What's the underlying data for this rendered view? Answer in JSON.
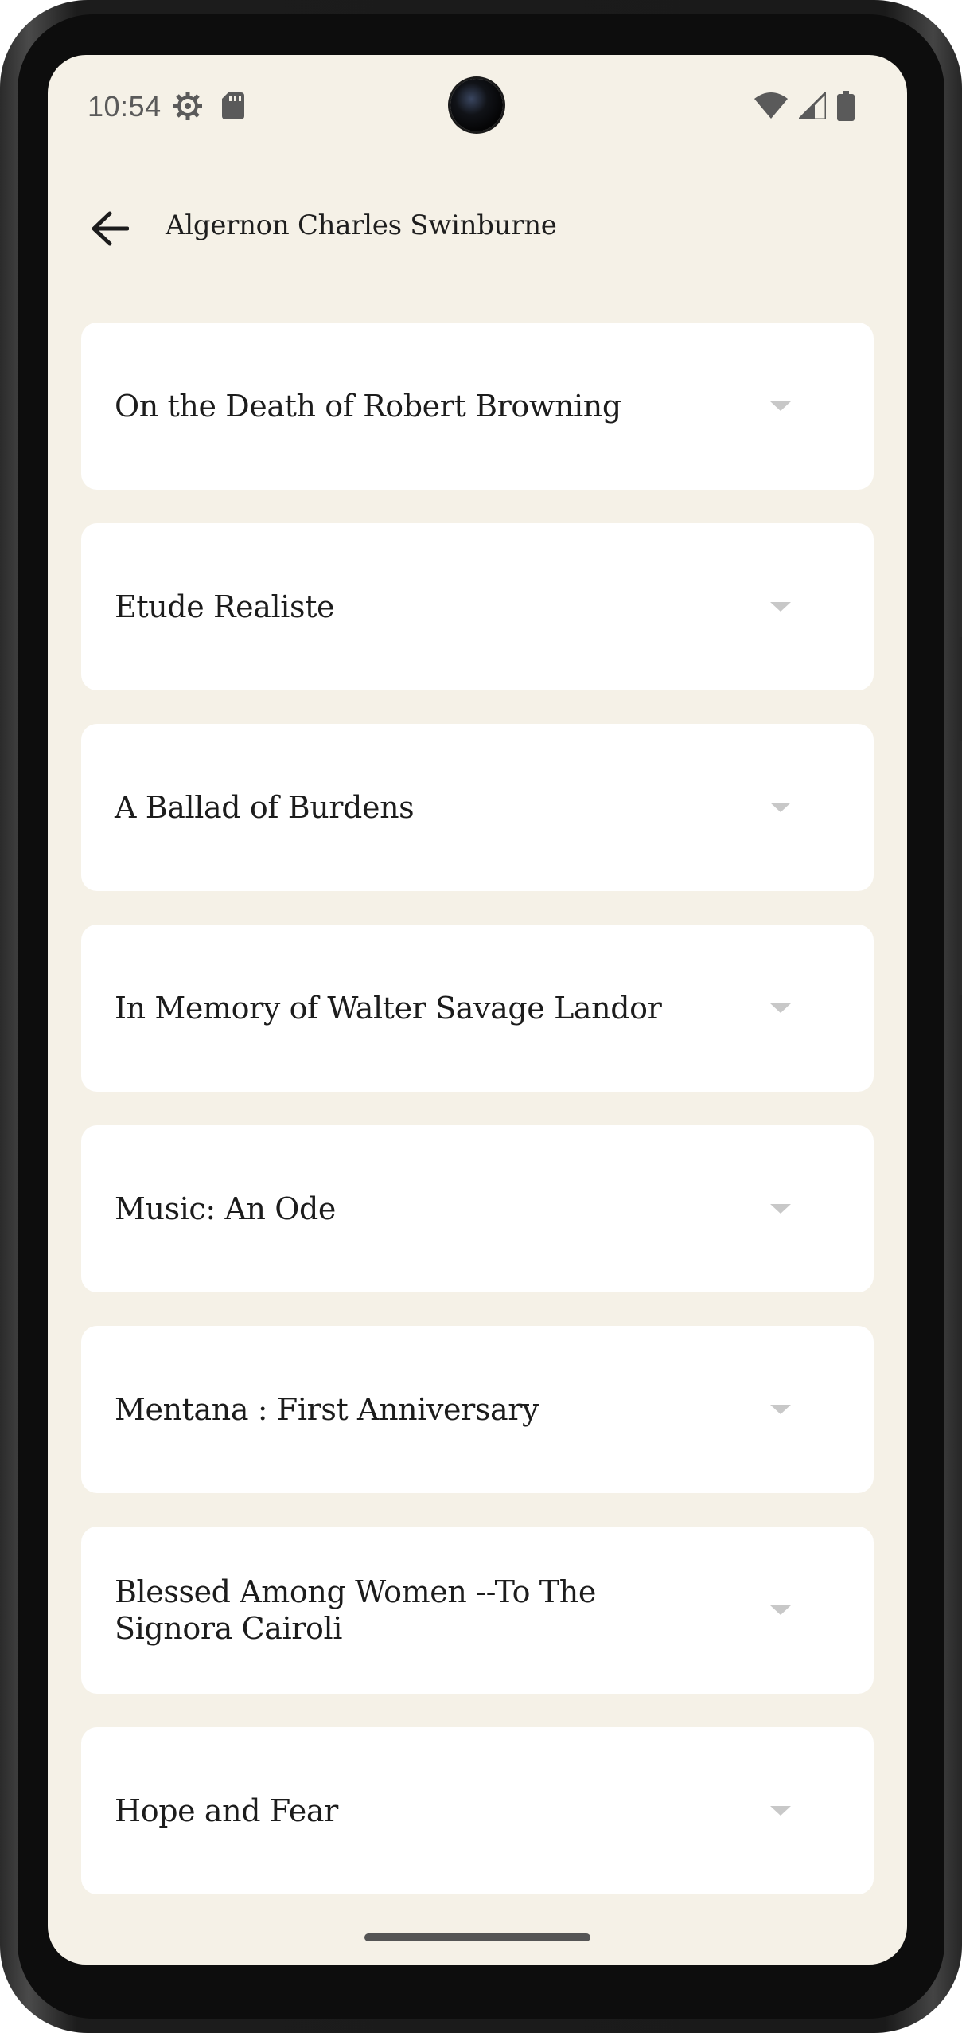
{
  "status_bar": {
    "time": "10:54",
    "icons_left": [
      "settings-gear-icon",
      "sd-card-icon"
    ],
    "icons_right": [
      "wifi-icon",
      "cellular-signal-icon",
      "battery-icon"
    ]
  },
  "app_bar": {
    "back_icon": "arrow-back-icon",
    "title": "Algernon Charles Swinburne"
  },
  "poems": [
    {
      "title": "On the Death of Robert Browning"
    },
    {
      "title": "Etude Realiste"
    },
    {
      "title": "A Ballad of Burdens"
    },
    {
      "title": "In Memory of Walter Savage Landor"
    },
    {
      "title": "Music: An Ode"
    },
    {
      "title": "Mentana : First Anniversary"
    },
    {
      "title": "Blessed Among Women --To The Signora Cairoli"
    },
    {
      "title": "Hope and Fear"
    }
  ],
  "colors": {
    "background": "#f5f1e7",
    "card": "#ffffff",
    "text": "#1c1c1c",
    "chevron": "#c8c8c8"
  }
}
